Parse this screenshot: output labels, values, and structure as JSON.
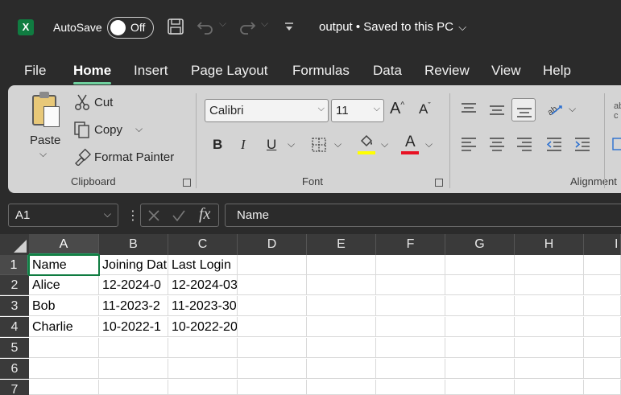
{
  "titlebar": {
    "app_icon": "excel-icon",
    "app_letter": "X",
    "autosave_label": "AutoSave",
    "autosave_state": "Off",
    "doc_title": "output • Saved to this PC",
    "title_chevron": "⌵"
  },
  "menu": {
    "tabs": [
      "File",
      "Home",
      "Insert",
      "Page Layout",
      "Formulas",
      "Data",
      "Review",
      "View",
      "Help"
    ],
    "active": "Home"
  },
  "ribbon": {
    "clipboard": {
      "paste": "Paste",
      "cut": "Cut",
      "copy": "Copy",
      "format_painter": "Format Painter",
      "group_label": "Clipboard"
    },
    "font": {
      "font_name": "Calibri",
      "font_size": "11",
      "bold": "B",
      "italic": "I",
      "underline": "U",
      "font_color_letter": "A",
      "group_label": "Font",
      "highlight_color": "#ffff00",
      "font_color": "#e81123"
    },
    "alignment": {
      "group_label": "Alignment"
    }
  },
  "formula_bar": {
    "name_box": "A1",
    "fx": "fx",
    "content": "Name"
  },
  "sheet": {
    "columns": [
      "A",
      "B",
      "C",
      "D",
      "E",
      "F",
      "G",
      "H",
      "I"
    ],
    "rows": [
      "1",
      "2",
      "3",
      "4",
      "5",
      "6",
      "7"
    ],
    "active_cell": "A1",
    "cells": [
      [
        "Name",
        "Joining Dat",
        "Last Login"
      ],
      [
        "Alice",
        "12-2024-0",
        "12-2024-03"
      ],
      [
        "Bob",
        "11-2023-2",
        "11-2023-30"
      ],
      [
        "Charlie",
        "10-2022-1",
        "10-2022-20"
      ]
    ]
  },
  "colors": {
    "accent": "#107c41",
    "tab_underline": "#6fd09e",
    "chrome_bg": "#2b2b2b",
    "ribbon_bg": "#d4d4d4"
  }
}
